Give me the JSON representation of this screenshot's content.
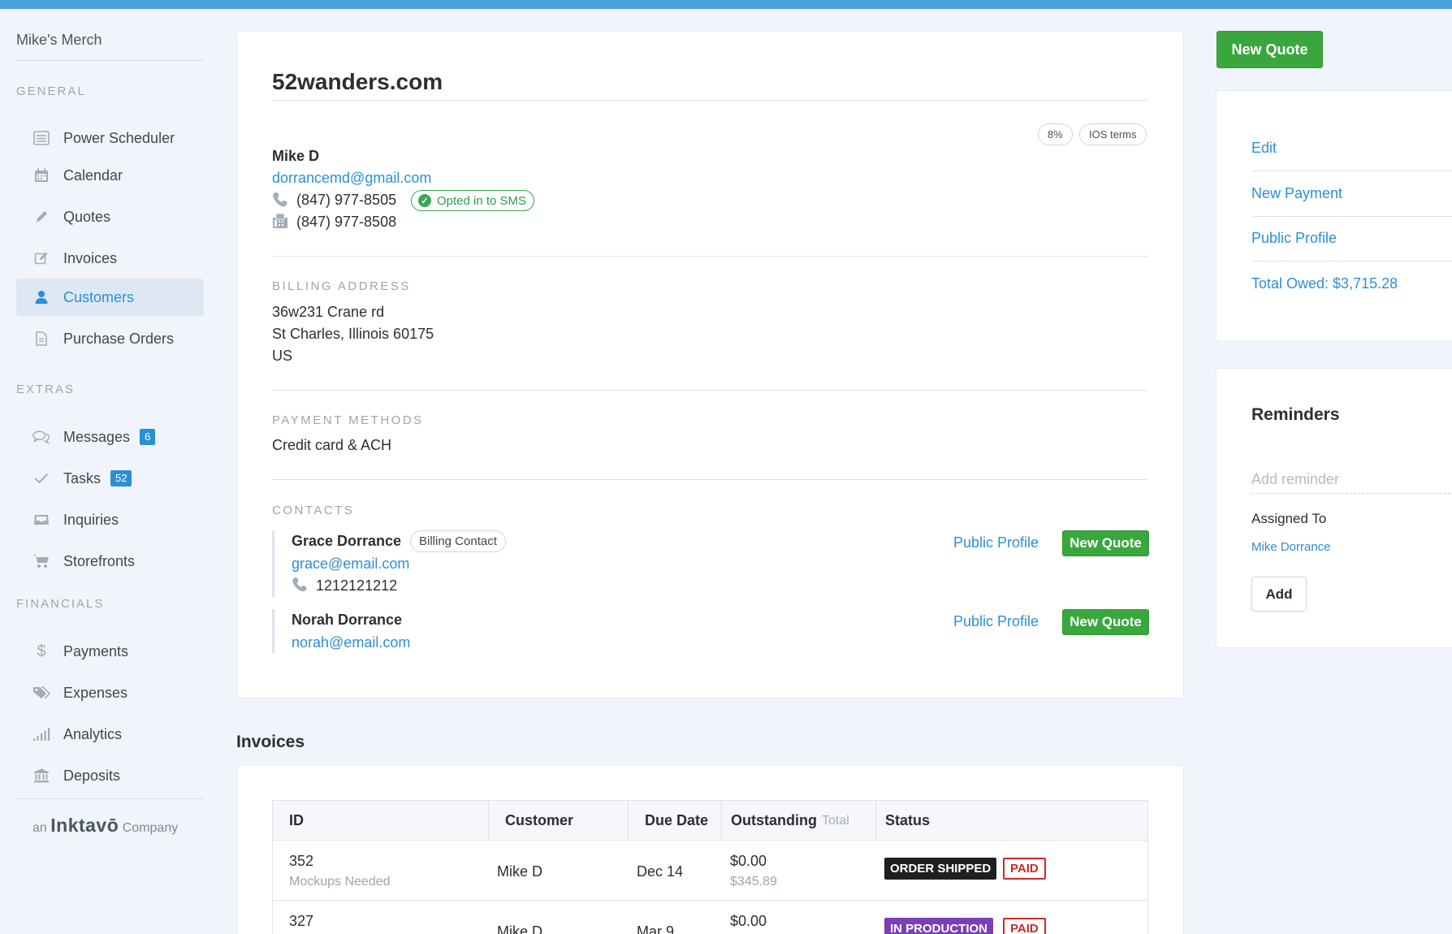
{
  "sidebar": {
    "brand": "Mike's Merch",
    "sections": {
      "general": "GENERAL",
      "extras": "EXTRAS",
      "financials": "FINANCIALS"
    },
    "items": [
      {
        "label": "Power Scheduler",
        "icon": "list-icon"
      },
      {
        "label": "Calendar",
        "icon": "calendar-icon"
      },
      {
        "label": "Quotes",
        "icon": "pencil-icon"
      },
      {
        "label": "Invoices",
        "icon": "edit-icon"
      },
      {
        "label": "Customers",
        "icon": "user-icon",
        "active": true
      },
      {
        "label": "Purchase Orders",
        "icon": "document-icon"
      },
      {
        "label": "Messages",
        "icon": "chat-icon",
        "badge": "6"
      },
      {
        "label": "Tasks",
        "icon": "check-icon",
        "badge": "52"
      },
      {
        "label": "Inquiries",
        "icon": "inbox-icon"
      },
      {
        "label": "Storefronts",
        "icon": "cart-icon"
      },
      {
        "label": "Payments",
        "icon": "dollar-icon"
      },
      {
        "label": "Expenses",
        "icon": "tag-icon"
      },
      {
        "label": "Analytics",
        "icon": "bars-icon"
      },
      {
        "label": "Deposits",
        "icon": "bank-icon"
      }
    ],
    "footer": {
      "prefix": "an",
      "logo": "Inktavō",
      "suffix": "Company"
    }
  },
  "customer": {
    "title": "52wanders.com",
    "pills": [
      "8%",
      "IOS terms"
    ],
    "name": "Mike D",
    "email": "dorrancemd@gmail.com",
    "phone": "(847) 977-8505",
    "sms_status": "Opted in to SMS",
    "fax": "(847) 977-8508",
    "billing_heading": "BILLING ADDRESS",
    "address": [
      "36w231 Crane rd",
      "St Charles, Illinois 60175",
      "US"
    ],
    "payment_heading": "PAYMENT METHODS",
    "payment_methods": "Credit card & ACH",
    "contacts_heading": "CONTACTS",
    "contacts": [
      {
        "name": "Grace Dorrance",
        "tag": "Billing Contact",
        "email": "grace@email.com",
        "phone": "1212121212",
        "profile": "Public Profile",
        "quote": "New Quote"
      },
      {
        "name": "Norah Dorrance",
        "email": "norah@email.com",
        "profile": "Public Profile",
        "quote": "New Quote"
      }
    ]
  },
  "invoices": {
    "title": "Invoices",
    "columns": {
      "id": "ID",
      "customer": "Customer",
      "due": "Due Date",
      "outstanding": "Outstanding",
      "outstanding_sub": "Total",
      "status": "Status"
    },
    "rows": [
      {
        "id": "352",
        "note": "Mockups Needed",
        "customer": "Mike D",
        "due": "Dec 14",
        "outstanding": "$0.00",
        "total": "$345.89",
        "status": "ORDER SHIPPED",
        "paid": "PAID"
      },
      {
        "id": "327",
        "note": "",
        "customer": "Mike D",
        "due": "Mar 9",
        "outstanding": "$0.00",
        "total": "",
        "status": "IN PRODUCTION",
        "paid": "PAID"
      }
    ]
  },
  "actions": {
    "new_quote": "New Quote",
    "links": [
      "Edit",
      "New Payment",
      "Public Profile",
      "Total Owed: $3,715.28"
    ]
  },
  "reminders": {
    "title": "Reminders",
    "placeholder": "Add reminder",
    "assigned_label": "Assigned To",
    "assignee": "Mike Dorrance",
    "add_button": "Add"
  },
  "colors": {
    "accent": "#2c8fd6",
    "topbar": "#4ba3dc",
    "green": "#3aa73e"
  }
}
